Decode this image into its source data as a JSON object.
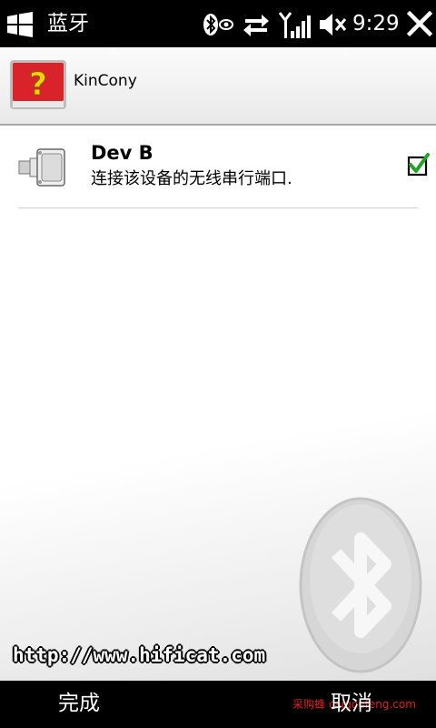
{
  "status_bar": {
    "title": "蓝牙",
    "time": "9:29",
    "icons": [
      "windows-start-icon",
      "bluetooth-visible-icon",
      "data-sync-icon",
      "signal-strength-icon",
      "volume-muted-icon",
      "close-icon"
    ]
  },
  "device_header": {
    "name": "KinCony",
    "icon": "unknown-device-icon"
  },
  "services": [
    {
      "icon": "serial-port-icon",
      "title": "Dev B",
      "description": "连接该设备的无线串行端口.",
      "checked": true
    }
  ],
  "watermark": "http://www.hificat.com",
  "credit": "采购蜂 caigoufeng.com",
  "softkeys": {
    "left": "完成",
    "right": "取消"
  },
  "colors": {
    "status_bar_bg": "#000000",
    "content_bg": "#ffffff",
    "check_green": "#22a322",
    "device_icon_red": "#d8232a",
    "device_icon_yellow": "#f6d000"
  }
}
